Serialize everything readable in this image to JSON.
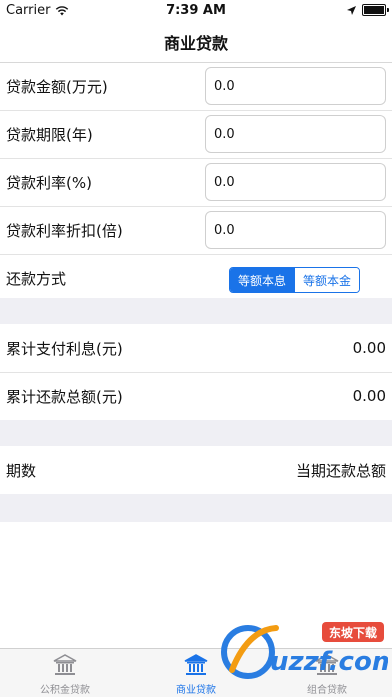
{
  "status": {
    "carrier": "Carrier",
    "time": "7:39 AM"
  },
  "nav": {
    "title": "商业贷款"
  },
  "form": {
    "rows": [
      {
        "label": "贷款金额(万元)",
        "value": "0.0"
      },
      {
        "label": "贷款期限(年)",
        "value": "0.0"
      },
      {
        "label": "贷款利率(%)",
        "value": "0.0"
      },
      {
        "label": "贷款利率折扣(倍)",
        "value": "0.0"
      }
    ],
    "method": {
      "label": "还款方式",
      "options": [
        "等额本息",
        "等额本金"
      ],
      "selected": "等额本息"
    }
  },
  "results": [
    {
      "label": "累计支付利息(元)",
      "value": "0.00"
    },
    {
      "label": "累计还款总额(元)",
      "value": "0.00"
    }
  ],
  "table": {
    "col1": "期数",
    "col2": "当期还款总额"
  },
  "tabs": [
    {
      "label": "公积金贷款",
      "icon": "bank-icon"
    },
    {
      "label": "商业贷款",
      "icon": "bank-icon"
    },
    {
      "label": "组合贷款",
      "icon": "bank-icon"
    }
  ],
  "watermark": {
    "text": "uzzf.com",
    "badge": "东坡下载"
  },
  "colors": {
    "accent": "#1a73e8",
    "separator": "#efeff4"
  }
}
